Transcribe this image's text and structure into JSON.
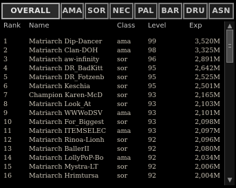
{
  "tabs": [
    {
      "label": "OVERALL",
      "active": true
    },
    {
      "label": "AMA",
      "active": false
    },
    {
      "label": "SOR",
      "active": false
    },
    {
      "label": "NEC",
      "active": false
    },
    {
      "label": "PAL",
      "active": false
    },
    {
      "label": "BAR",
      "active": false
    },
    {
      "label": "DRU",
      "active": false
    },
    {
      "label": "ASN",
      "active": false
    }
  ],
  "columns": {
    "rank": "Rank",
    "name": "Name",
    "class": "Class",
    "level": "Level",
    "exp": "Exp"
  },
  "rows": [
    {
      "rank": "1",
      "name": "Matriarch Dip-Dancer",
      "class": "ama",
      "level": "99",
      "exp": "3,520M"
    },
    {
      "rank": "2",
      "name": "Matriarch Clan-DOH",
      "class": "ama",
      "level": "98",
      "exp": "3,325M"
    },
    {
      "rank": "3",
      "name": "Matriarch aw-infinity",
      "class": "sor",
      "level": "96",
      "exp": "2,891M"
    },
    {
      "rank": "4",
      "name": "Matriarch DR_BadKitt",
      "class": "sor",
      "level": "95",
      "exp": "2,642M"
    },
    {
      "rank": "5",
      "name": "Matriarch DR_Fotzenb",
      "class": "sor",
      "level": "95",
      "exp": "2,525M"
    },
    {
      "rank": "6",
      "name": "Matriarch Keschia",
      "class": "sor",
      "level": "95",
      "exp": "2,501M"
    },
    {
      "rank": "7",
      "name": "Champion Karen-McD",
      "class": "sor",
      "level": "93",
      "exp": "2,165M"
    },
    {
      "rank": "8",
      "name": "Matriarch Look_At",
      "class": "sor",
      "level": "93",
      "exp": "2,103M"
    },
    {
      "rank": "9",
      "name": "Matriarch WWWoDSV",
      "class": "ama",
      "level": "93",
      "exp": "2,101M"
    },
    {
      "rank": "10",
      "name": "Matriarch For_Biggest",
      "class": "sor",
      "level": "93",
      "exp": "2,098M"
    },
    {
      "rank": "11",
      "name": "Matriarch ITEMSELEC",
      "class": "ama",
      "level": "93",
      "exp": "2,097M"
    },
    {
      "rank": "12",
      "name": "Matriarch Rinoa-Lionh",
      "class": "sor",
      "level": "92",
      "exp": "2,096M"
    },
    {
      "rank": "13",
      "name": "Matriarch BallerII",
      "class": "sor",
      "level": "92",
      "exp": "2,080M"
    },
    {
      "rank": "14",
      "name": "Matriarch LollyPoP-Bo",
      "class": "ama",
      "level": "92",
      "exp": "2,034M"
    },
    {
      "rank": "15",
      "name": "Matriarch Mystra-LT",
      "class": "sor",
      "level": "92",
      "exp": "2,006M"
    },
    {
      "rank": "16",
      "name": "Matriarch Hrimtursa",
      "class": "sor",
      "level": "92",
      "exp": "2,004M"
    }
  ]
}
